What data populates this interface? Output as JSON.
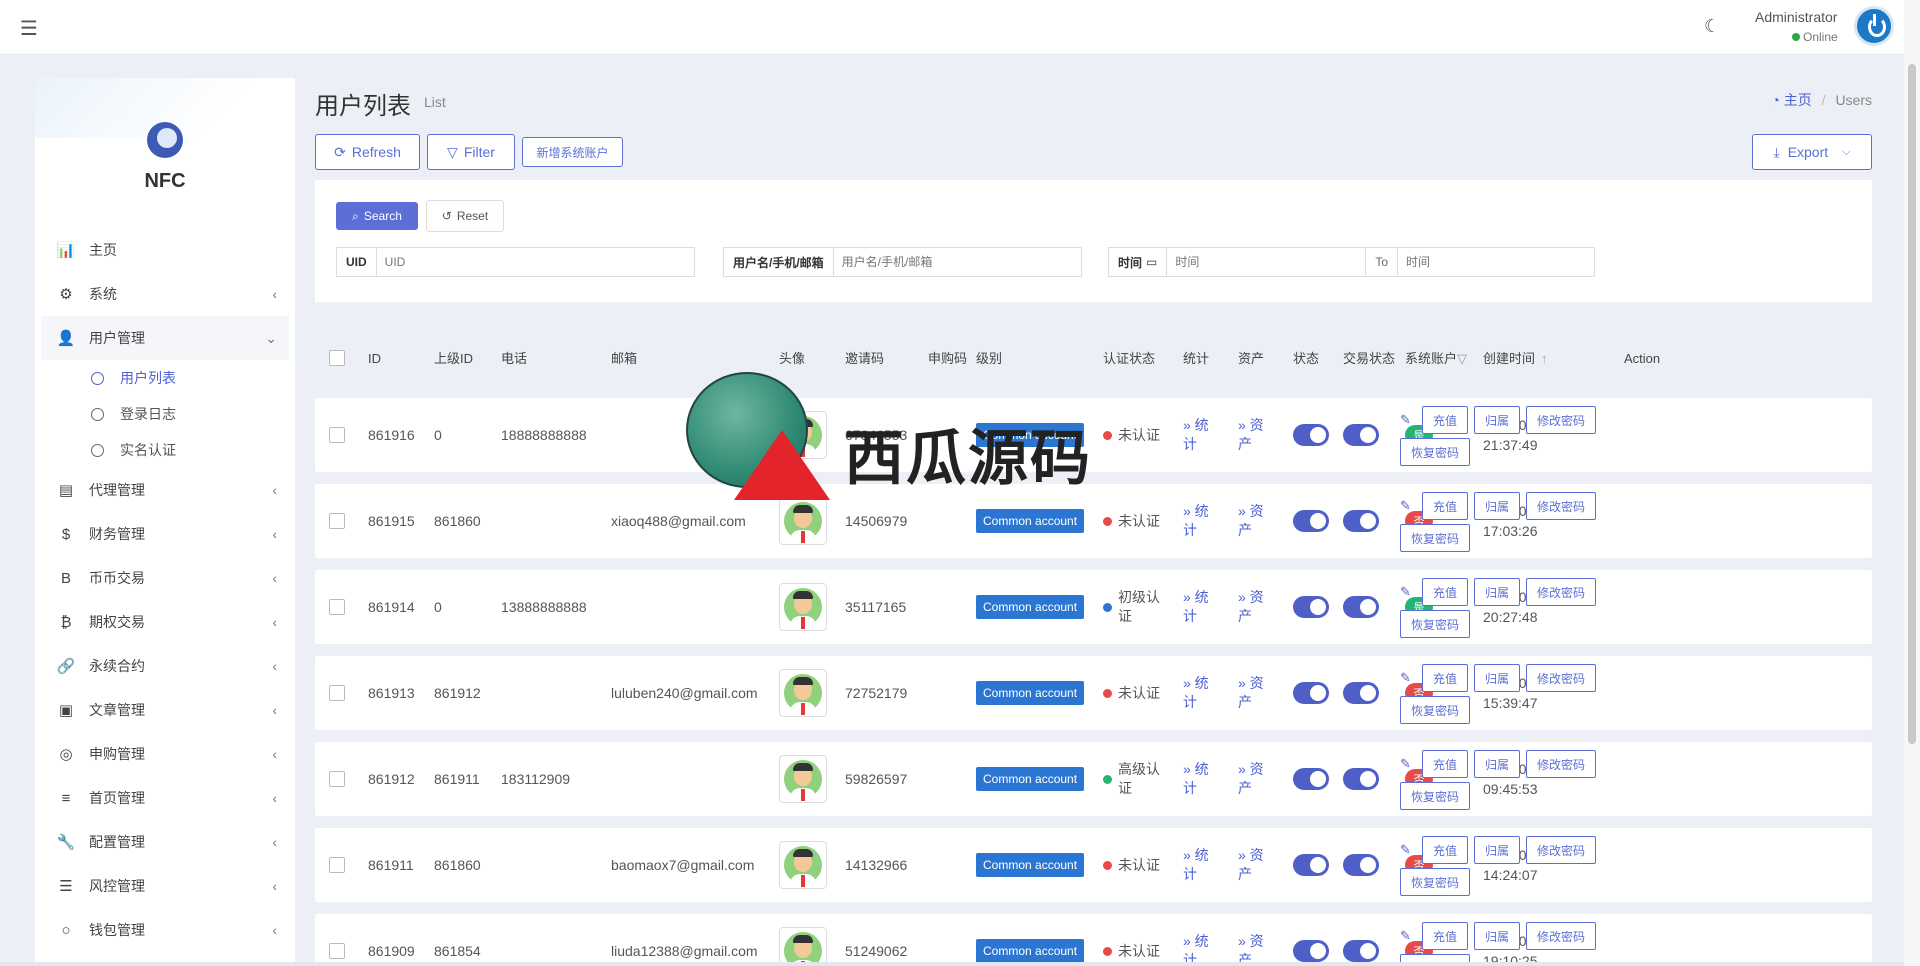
{
  "topbar": {
    "admin_name": "Administrator",
    "status": "Online"
  },
  "sidebar": {
    "brand": "NFC",
    "items": [
      {
        "label": "主页",
        "icon": "bar-chart-icon",
        "glyph": "📊"
      },
      {
        "label": "系统",
        "icon": "gear-icon",
        "glyph": "⚙"
      },
      {
        "label": "用户管理",
        "icon": "users-icon",
        "glyph": "👤"
      },
      {
        "label": "代理管理",
        "icon": "id-card-icon",
        "glyph": "▤"
      },
      {
        "label": "财务管理",
        "icon": "dollar-icon",
        "glyph": "$"
      },
      {
        "label": "币币交易",
        "icon": "bitcoin-b-icon",
        "glyph": "B"
      },
      {
        "label": "期权交易",
        "icon": "bitcoin-icon",
        "glyph": "₿"
      },
      {
        "label": "永续合约",
        "icon": "link-icon",
        "glyph": "🔗"
      },
      {
        "label": "文章管理",
        "icon": "newspaper-icon",
        "glyph": "▣"
      },
      {
        "label": "申购管理",
        "icon": "lifebuoy-icon",
        "glyph": "◎"
      },
      {
        "label": "首页管理",
        "icon": "list-icon",
        "glyph": "≡"
      },
      {
        "label": "配置管理",
        "icon": "wrench-icon",
        "glyph": "🔧"
      },
      {
        "label": "风控管理",
        "icon": "list-indent-icon",
        "glyph": "☰"
      },
      {
        "label": "钱包管理",
        "icon": "circle-icon",
        "glyph": "○"
      }
    ],
    "sub_items": [
      "用户列表",
      "登录日志",
      "实名认证"
    ]
  },
  "page": {
    "title": "用户列表",
    "subtitle": "List",
    "breadcrumb_home": "主页",
    "breadcrumb_separator": "/",
    "breadcrumb_current": "Users"
  },
  "toolbar": {
    "refresh": "Refresh",
    "filter": "Filter",
    "add_system": "新增系统账户",
    "export": "Export"
  },
  "search": {
    "search_label": "Search",
    "reset_label": "Reset",
    "uid_label": "UID",
    "uid_placeholder": "UID",
    "user_label": "用户名/手机/邮箱",
    "user_placeholder": "用户名/手机/邮箱",
    "time_label": "时间",
    "time_placeholder": "时间",
    "to_label": "To",
    "to_placeholder": "时间"
  },
  "table": {
    "headers": {
      "id": "ID",
      "parent": "上级ID",
      "phone": "电话",
      "email": "邮箱",
      "avatar": "头像",
      "invite": "邀请码",
      "subscribe_1": "申购",
      "subscribe_2": "码",
      "level": "级别",
      "auth": "认证状态",
      "stats": "统计",
      "assets": "资产",
      "status": "状态",
      "trade_1": "交易状",
      "trade_2": "态",
      "system_account": "系统账户",
      "created": "创建时间",
      "action": "Action"
    },
    "rows": [
      {
        "id": "861916",
        "parent": "0",
        "phone": "18888888888",
        "email": "",
        "invite": "67846553",
        "level": "Common account",
        "auth": "未认证",
        "auth_color": "#e84a4a",
        "sys": "是",
        "sys_yes": true,
        "date": "2022-05-15",
        "clock": "21:37:49"
      },
      {
        "id": "861915",
        "parent": "861860",
        "phone": "",
        "email": "xiaoq488@gmail.com",
        "invite": "14506979",
        "level": "Common account",
        "auth": "未认证",
        "auth_color": "#e84a4a",
        "sys": "否",
        "sys_yes": false,
        "date": "2022-05-06",
        "clock": "17:03:26"
      },
      {
        "id": "861914",
        "parent": "0",
        "phone": "13888888888",
        "email": "",
        "invite": "35117165",
        "level": "Common account",
        "auth": "初级认证",
        "auth_color": "#2a76d2",
        "sys": "是",
        "sys_yes": true,
        "date": "2022-04-28",
        "clock": "20:27:48"
      },
      {
        "id": "861913",
        "parent": "861912",
        "phone": "",
        "email": "luluben240@gmail.com",
        "invite": "72752179",
        "level": "Common account",
        "auth": "未认证",
        "auth_color": "#e84a4a",
        "sys": "否",
        "sys_yes": false,
        "date": "2022-04-20",
        "clock": "15:39:47"
      },
      {
        "id": "861912",
        "parent": "861911",
        "phone": "183112909",
        "email": "",
        "invite": "59826597",
        "level": "Common account",
        "auth": "高级认证",
        "auth_color": "#22b573",
        "sys": "否",
        "sys_yes": false,
        "date": "2022-04-20",
        "clock": "09:45:53"
      },
      {
        "id": "861911",
        "parent": "861860",
        "phone": "",
        "email": "baomaox7@gmail.com",
        "invite": "14132966",
        "level": "Common account",
        "auth": "未认证",
        "auth_color": "#e84a4a",
        "sys": "否",
        "sys_yes": false,
        "date": "2022-04-18",
        "clock": "14:24:07"
      },
      {
        "id": "861909",
        "parent": "861854",
        "phone": "",
        "email": "liuda12388@gmail.com",
        "invite": "51249062",
        "level": "Common account",
        "auth": "未认证",
        "auth_color": "#e84a4a",
        "sys": "否",
        "sys_yes": false,
        "date": "2022-01-14",
        "clock": "19:10:25"
      }
    ],
    "links": {
      "stats": "» 统计",
      "assets": "» 资产"
    },
    "actions": {
      "recharge": "充值",
      "assign": "归属",
      "change_pwd": "修改密码",
      "reset_pwd": "恢复密码"
    }
  },
  "watermark": {
    "text": "西瓜源码"
  }
}
